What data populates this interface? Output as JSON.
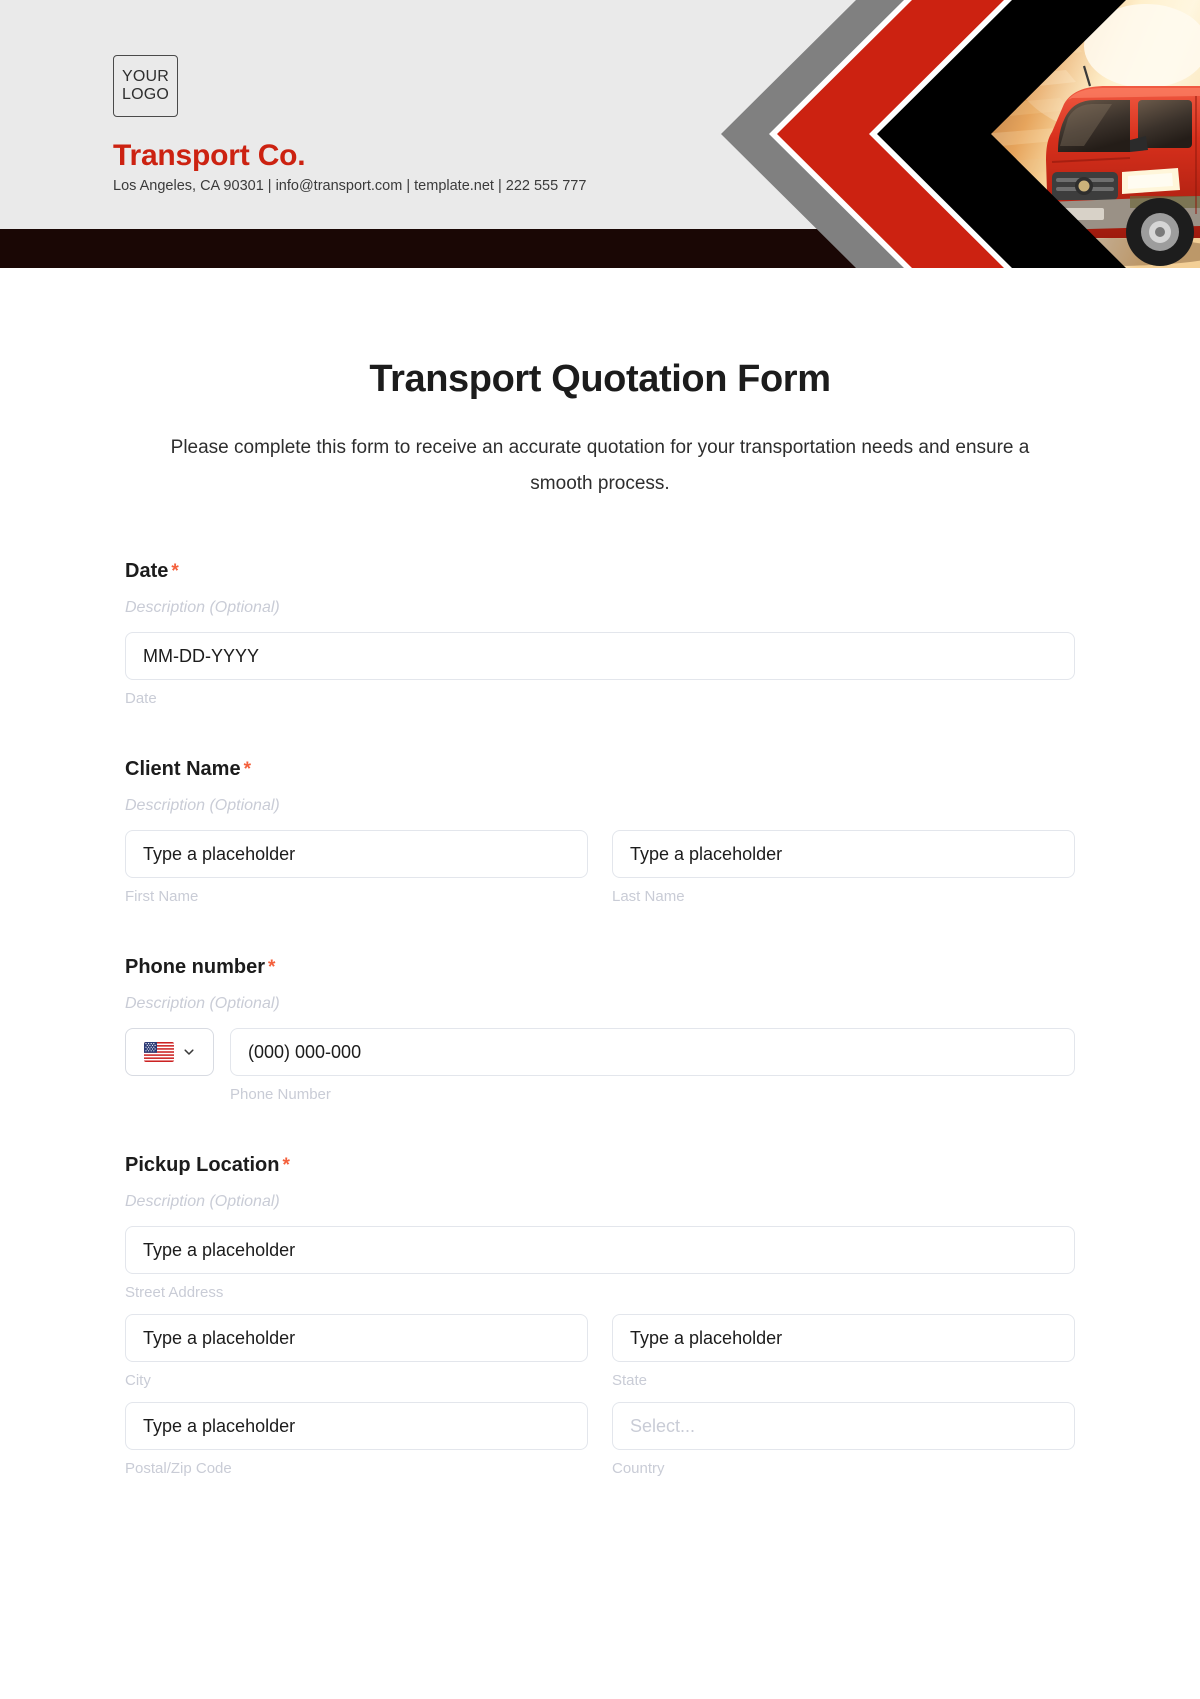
{
  "header": {
    "logo_line1": "YOUR",
    "logo_line2": "LOGO",
    "company_name": "Transport Co.",
    "company_contact": "Los Angeles, CA 90301 | info@transport.com | template.net | 222 555 777",
    "colors": {
      "background": "#eaeaea",
      "dark_band": "#1a0705",
      "brand_red": "#cc2211",
      "chevron_gray": "#808080",
      "chevron_red": "#cc2211",
      "chevron_black": "#000000"
    }
  },
  "form": {
    "title": "Transport Quotation Form",
    "description": "Please complete this form to receive an accurate quotation for your transportation needs and ensure a smooth process.",
    "required_marker": "*",
    "description_placeholder": "Description (Optional)",
    "fields": [
      {
        "label": "Date",
        "required": true,
        "description": "Description (Optional)",
        "inputs": [
          {
            "placeholder": "MM-DD-YYYY",
            "sublabel": "Date",
            "type": "text"
          }
        ]
      },
      {
        "label": "Client Name",
        "required": true,
        "description": "Description (Optional)",
        "inputs": [
          {
            "placeholder": "Type a placeholder",
            "sublabel": "First Name",
            "type": "text"
          },
          {
            "placeholder": "Type a placeholder",
            "sublabel": "Last Name",
            "type": "text"
          }
        ]
      },
      {
        "label": "Phone number",
        "required": true,
        "description": "Description (Optional)",
        "country_flag": "us-flag-icon",
        "inputs": [
          {
            "placeholder": "(000) 000-000",
            "sublabel": "Phone Number",
            "type": "tel"
          }
        ]
      },
      {
        "label": "Pickup Location",
        "required": true,
        "description": "Description (Optional)",
        "inputs": [
          {
            "placeholder": "Type a placeholder",
            "sublabel": "Street Address",
            "type": "text"
          },
          {
            "placeholder": "Type a placeholder",
            "sublabel": "City",
            "type": "text"
          },
          {
            "placeholder": "Type a placeholder",
            "sublabel": "State",
            "type": "text"
          },
          {
            "placeholder": "Type a placeholder",
            "sublabel": "Postal/Zip Code",
            "type": "text"
          },
          {
            "placeholder": "Select...",
            "sublabel": "Country",
            "type": "select"
          }
        ]
      }
    ]
  }
}
